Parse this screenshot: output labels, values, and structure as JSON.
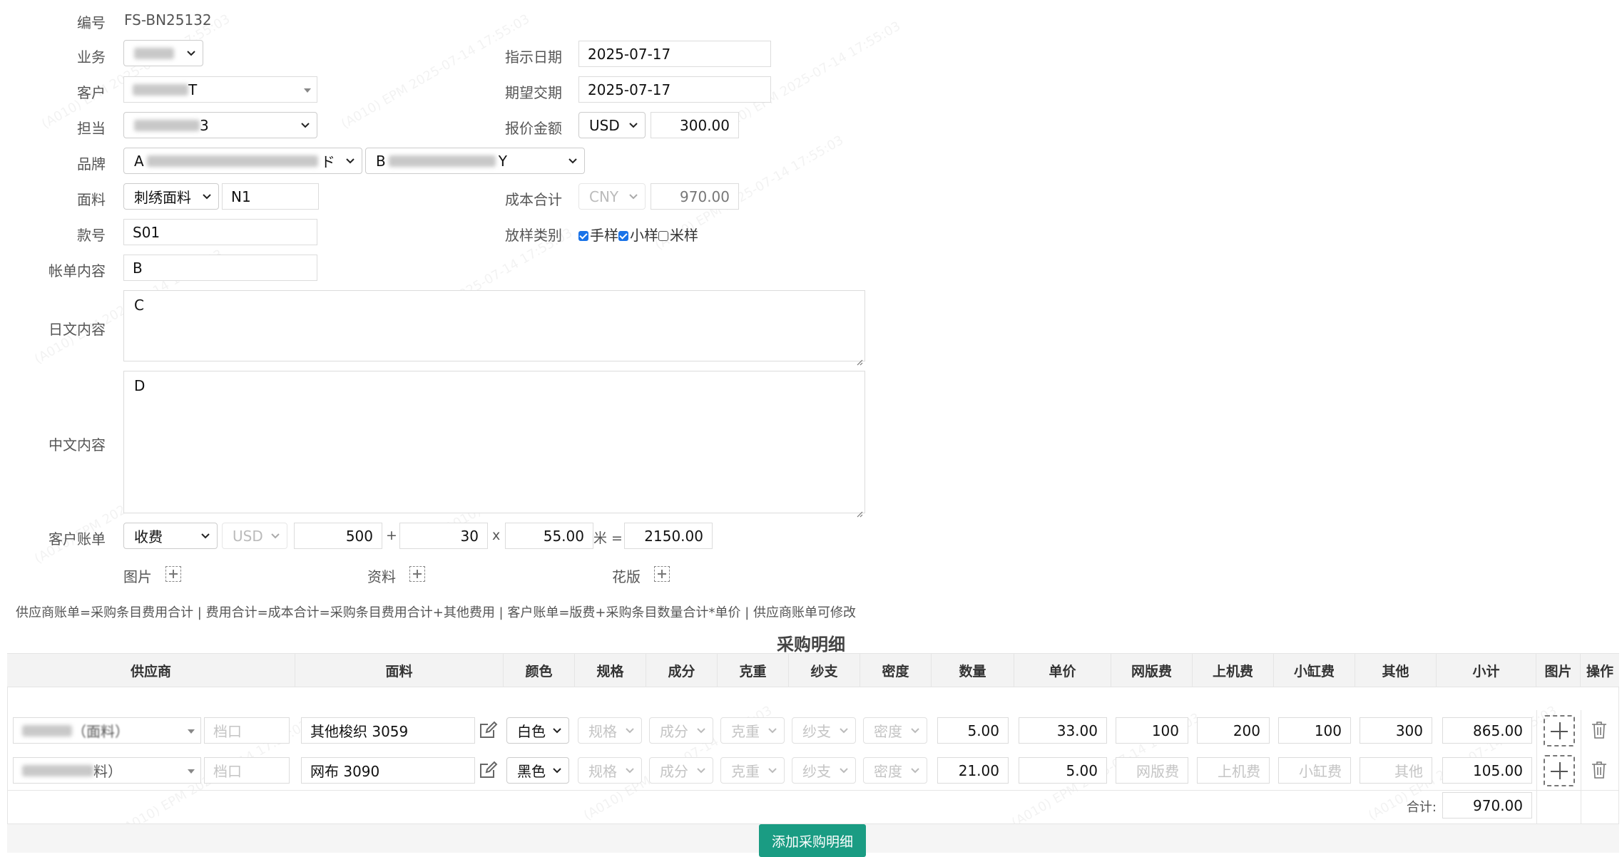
{
  "form": {
    "number_label": "编号",
    "number_value": "FS-BN25132",
    "business_label": "业务",
    "customer_label": "客户",
    "customer_suffix": "T",
    "owner_label": "担当",
    "owner_suffix": "3",
    "brand_label": "品牌",
    "brand1_prefix": "A",
    "brand1_suffix": "ド",
    "brand2_prefix": "B",
    "brand2_suffix": "Y",
    "fabric_label": "面料",
    "fabric_type": "刺绣面料",
    "fabric_code": "N1",
    "style_label": "款号",
    "style_value": "S01",
    "bill_label": "帐单内容",
    "bill_value": "B",
    "jp_label": "日文内容",
    "jp_value": "C",
    "cn_label": "中文内容",
    "cn_value": "D",
    "instruct_date_label": "指示日期",
    "instruct_date_value": "2025-07-17",
    "expect_date_label": "期望交期",
    "expect_date_value": "2025-07-17",
    "quote_label": "报价金额",
    "quote_currency": "USD",
    "quote_amount": "300.00",
    "cost_label": "成本合计",
    "cost_currency": "CNY",
    "cost_amount": "970.00",
    "sample_label": "放样类别",
    "sample_options": [
      "手样",
      "小样",
      "米样"
    ],
    "client_bill_label": "客户账单",
    "client_bill_type": "收费",
    "client_bill_currency": "USD",
    "client_bill_a": "500",
    "plus_sign": "+",
    "client_bill_b": "30",
    "times_sign": "x",
    "client_bill_c": "55.00",
    "meter_eq": "米 =",
    "client_bill_total": "2150.00",
    "image_label": "图片",
    "material_label": "资料",
    "pattern_label": "花版"
  },
  "formula_note": "供应商账单=采购条目费用合计 | 费用合计=成本合计=采购条目费用合计+其他费用 | 客户账单=版费+采购条目数量合计*单价 | 供应商账单可修改",
  "table": {
    "title": "采购明细",
    "headers": [
      "供应商",
      "面料",
      "颜色",
      "规格",
      "成分",
      "克重",
      "纱支",
      "密度",
      "数量",
      "单价",
      "网版费",
      "上机费",
      "小缸费",
      "其他",
      "小计",
      "图片",
      "操作"
    ],
    "placeholders": {
      "stall": "档口",
      "spec": "规格",
      "comp": "成分",
      "weight": "克重",
      "yarn": "纱支",
      "density": "密度",
      "screen": "网版费",
      "machine": "上机费",
      "dye": "小缸费",
      "other": "其他"
    },
    "rows": [
      {
        "supplier_suffix": "（面料）",
        "fabric": "其他梭织 3059",
        "color": "白色",
        "qty": "5.00",
        "price": "33.00",
        "screen": "100",
        "machine": "200",
        "dye": "100",
        "other": "300",
        "subtotal": "865.00"
      },
      {
        "supplier_suffix": "料）",
        "fabric": "网布 3090",
        "color": "黑色",
        "qty": "21.00",
        "price": "5.00",
        "screen": "",
        "machine": "",
        "dye": "",
        "other": "",
        "subtotal": "105.00"
      }
    ],
    "total_label": "合计:",
    "total_value": "970.00",
    "add_button": "添加采购明细"
  },
  "watermark": "(A010) EPM 2025-07-14 17:55:03",
  "colors": {
    "accent": "#1a9c83",
    "checkbox": "#1a73e8"
  }
}
